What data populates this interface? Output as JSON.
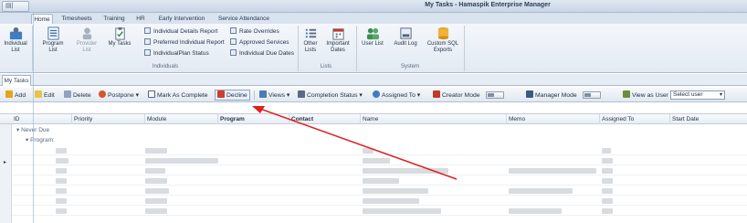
{
  "window": {
    "title": "My Tasks - Hamaspik Enterprise Manager",
    "app_menu_glyph": "▤|"
  },
  "ribbon_tabs": [
    "Home",
    "Timesheets",
    "Training",
    "HR",
    "Early Intervention",
    "Service Attendance"
  ],
  "ribbon": {
    "individual_list": "Individual List",
    "program_list": "Program List",
    "provider_list": "Provider List",
    "my_tasks": "My Tasks",
    "small_col1": [
      "Individual Details Report",
      "Preferred Individual Report",
      "IndividualPlan Status"
    ],
    "small_col2": [
      "Rate Overrides",
      "Approved Services",
      "Individual Due Dates"
    ],
    "group_individuals": "Individuals",
    "other_lists": "Other Lists",
    "important_dates": "Important Dates",
    "group_lists": "Lists",
    "user_list": "User List",
    "audit_log": "Audit Log",
    "custom_sql_exports": "Custom SQL Exports",
    "group_system": "System"
  },
  "doc_tab": "My Tasks",
  "toolbar": {
    "add": "Add",
    "edit": "Edit",
    "delete": "Delete",
    "postpone": "Postpone",
    "mark_complete": "Mark As Complete",
    "decline": "Decline",
    "views": "Views",
    "completion_status": "Completion Status",
    "assigned_to": "Assigned To",
    "creator_mode": "Creator Mode",
    "manager_mode": "Manager Mode",
    "view_as_user": "View as User",
    "select_user": "Select user"
  },
  "grid": {
    "columns": [
      "ID",
      "Priority",
      "Module",
      "Program",
      "Contact",
      "Name",
      "Memo",
      "Assigned To",
      "Start Date"
    ],
    "group_never_due": "Never Due",
    "group_program": "Program:"
  },
  "colors": {
    "annotation_arrow": "#e02020",
    "ribbon_bg": "#e3eaf3"
  }
}
